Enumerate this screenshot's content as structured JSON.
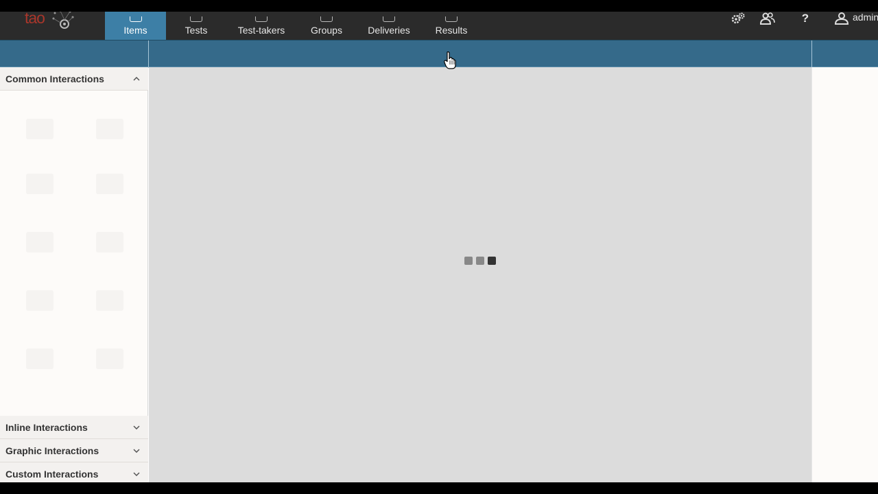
{
  "topbar": {
    "logo_text": "tao",
    "nav": [
      {
        "label": "Items",
        "active": true
      },
      {
        "label": "Tests",
        "active": false
      },
      {
        "label": "Test-takers",
        "active": false
      },
      {
        "label": "Groups",
        "active": false
      },
      {
        "label": "Deliveries",
        "active": false
      },
      {
        "label": "Results",
        "active": false
      }
    ],
    "tools": {
      "settings_icon": "gears-icon",
      "users_icon": "users-icon",
      "help_label": "?",
      "user_icon": "user-icon",
      "user_label": "admin"
    }
  },
  "sidebar": {
    "panels": [
      {
        "label": "Common Interactions",
        "expanded": true
      },
      {
        "label": "Inline Interactions",
        "expanded": false
      },
      {
        "label": "Graphic Interactions",
        "expanded": false
      },
      {
        "label": "Custom Interactions",
        "expanded": false
      }
    ]
  },
  "canvas": {
    "loading": true
  },
  "colors": {
    "topbar_bg": "#2b2b2b",
    "accent": "#3d7fa6",
    "toolbar_bg": "#356a8a",
    "canvas_bg": "#dcdcdc"
  }
}
